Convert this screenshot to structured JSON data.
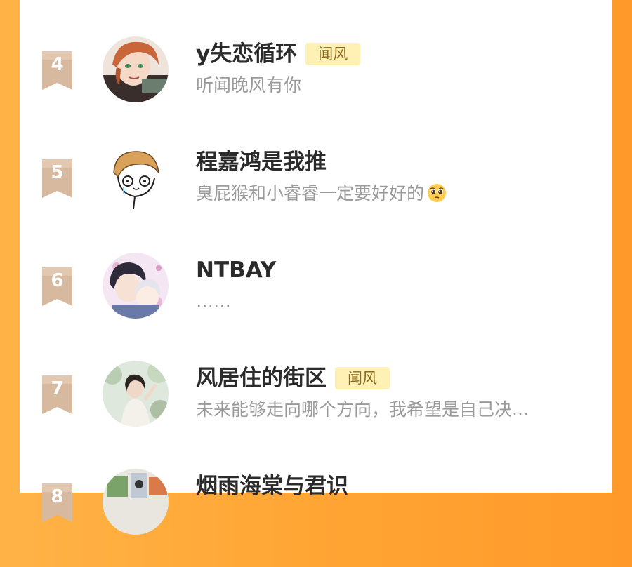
{
  "items": [
    {
      "rank": "4",
      "name": "y失恋循环",
      "tag": "闻风",
      "subtitle": "听闻晚风有你",
      "avatar": "avatar-red-hair-boy"
    },
    {
      "rank": "5",
      "name": "程嘉鸿是我推",
      "tag": "",
      "subtitle": "臭屁猴和小睿睿一定要好好的",
      "subtitle_emoji": "pleading-face-emoji",
      "avatar": "avatar-cartoon-boy-sketch"
    },
    {
      "rank": "6",
      "name": "NTBAY",
      "tag": "",
      "subtitle": "……",
      "avatar": "avatar-anime-couple"
    },
    {
      "rank": "7",
      "name": "风居住的街区",
      "tag": "闻风",
      "subtitle": "未来能够走向哪个方向，我希望是自己决...",
      "avatar": "avatar-girl-in-garden"
    },
    {
      "rank": "8",
      "name": "烟雨海棠与君识",
      "tag": "",
      "subtitle": "",
      "avatar": "avatar-comic-scene"
    }
  ],
  "colors": {
    "background_orange": "#ffa534",
    "rank_badge": "#d7b9a0",
    "tag_bg": "#fff0b3",
    "tag_text": "#8a6a1f",
    "name_text": "#2b2b2b",
    "sub_text": "#9a9a9a"
  }
}
